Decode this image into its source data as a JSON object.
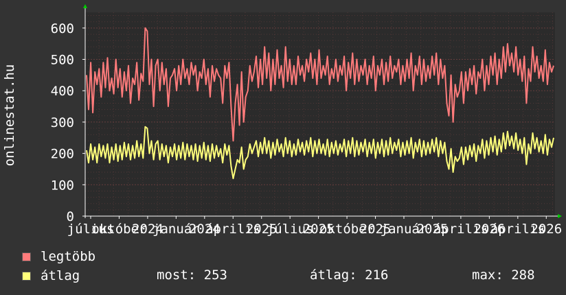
{
  "side_label": "onlinestat.hu",
  "legend": [
    {
      "name": "legtöbb",
      "color": "#ff7b7b"
    },
    {
      "name": "átlag",
      "color": "#ffff7b"
    }
  ],
  "stats": {
    "now": "most: 253",
    "avg": "átlag: 216",
    "max": "max: 288"
  },
  "colors": {
    "background": "#333333",
    "plot_bg": "#2b2b2b",
    "grid": "#6a3f3f",
    "axis": "#ffffff",
    "arrow": "#00cc00"
  },
  "chart_data": {
    "type": "line",
    "ylim": [
      0,
      650
    ],
    "yticks": [
      0,
      100,
      200,
      300,
      400,
      500,
      600
    ],
    "xtick_labels": [
      "július",
      "október",
      "2024",
      "január",
      "2024",
      "április",
      "2025",
      "július",
      "2025",
      "október",
      "2025",
      "január",
      "2025",
      "április",
      "2026",
      "április",
      "2026"
    ],
    "series": [
      {
        "name": "legtöbb",
        "color": "#ff7b7b",
        "values": [
          450,
          340,
          490,
          330,
          460,
          420,
          470,
          380,
          490,
          410,
          505,
          400,
          440,
          390,
          500,
          410,
          470,
          380,
          460,
          400,
          480,
          360,
          440,
          420,
          490,
          370,
          455,
          430,
          600,
          590,
          420,
          500,
          350,
          480,
          500,
          400,
          490,
          420,
          470,
          350,
          440,
          450,
          470,
          400,
          480,
          420,
          500,
          440,
          470,
          420,
          490,
          450,
          480,
          400,
          460,
          440,
          500,
          420,
          470,
          380,
          480,
          430,
          470,
          450,
          440,
          360,
          480,
          440,
          490,
          350,
          240,
          360,
          420,
          290,
          460,
          300,
          380,
          400,
          480,
          430,
          460,
          510,
          410,
          500,
          420,
          540,
          440,
          520,
          400,
          500,
          420,
          530,
          440,
          480,
          410,
          540,
          430,
          500,
          420,
          480,
          420,
          510,
          450,
          480,
          430,
          500,
          460,
          520,
          440,
          500,
          420,
          530,
          440,
          480,
          450,
          510,
          420,
          470,
          440,
          500,
          430,
          480,
          450,
          510,
          400,
          490,
          440,
          520,
          420,
          500,
          430,
          480,
          450,
          500,
          420,
          480,
          440,
          510,
          400,
          480,
          450,
          500,
          420,
          490,
          430,
          510,
          440,
          480,
          460,
          500,
          420,
          480,
          430,
          500,
          440,
          520,
          400,
          480,
          450,
          510,
          420,
          500,
          430,
          480,
          440,
          510,
          450,
          520,
          420,
          500,
          440,
          480,
          360,
          320,
          450,
          300,
          420,
          380,
          400,
          460,
          360,
          460,
          400,
          470,
          420,
          480,
          390,
          460,
          440,
          500,
          400,
          480,
          420,
          510,
          450,
          520,
          420,
          500,
          440,
          540,
          460,
          550,
          480,
          520,
          460,
          540,
          450,
          500,
          430,
          510,
          360,
          470,
          430,
          540,
          460,
          510,
          440,
          480,
          430,
          530,
          420,
          490,
          460,
          480
        ]
      },
      {
        "name": "átlag",
        "color": "#ffff7b",
        "values": [
          210,
          170,
          230,
          180,
          220,
          170,
          230,
          190,
          225,
          185,
          230,
          170,
          220,
          180,
          230,
          175,
          225,
          180,
          235,
          190,
          230,
          180,
          225,
          185,
          240,
          190,
          230,
          185,
          285,
          280,
          200,
          240,
          180,
          230,
          240,
          180,
          230,
          190,
          225,
          170,
          220,
          190,
          230,
          180,
          225,
          185,
          235,
          180,
          230,
          190,
          225,
          180,
          230,
          175,
          225,
          185,
          235,
          180,
          225,
          175,
          230,
          185,
          225,
          190,
          215,
          170,
          230,
          195,
          225,
          160,
          120,
          150,
          180,
          170,
          220,
          150,
          180,
          190,
          230,
          200,
          220,
          240,
          190,
          235,
          200,
          250,
          200,
          240,
          185,
          235,
          195,
          245,
          205,
          230,
          190,
          250,
          200,
          240,
          190,
          230,
          195,
          245,
          205,
          235,
          195,
          240,
          205,
          250,
          190,
          240,
          200,
          245,
          200,
          230,
          195,
          245,
          190,
          235,
          200,
          240,
          195,
          230,
          205,
          245,
          190,
          240,
          200,
          250,
          190,
          240,
          195,
          235,
          205,
          245,
          190,
          235,
          200,
          245,
          185,
          235,
          200,
          245,
          190,
          240,
          195,
          250,
          200,
          235,
          210,
          245,
          190,
          235,
          195,
          240,
          200,
          250,
          185,
          235,
          205,
          245,
          190,
          240,
          195,
          235,
          200,
          245,
          205,
          250,
          190,
          240,
          200,
          235,
          175,
          150,
          215,
          140,
          190,
          175,
          185,
          220,
          165,
          220,
          180,
          225,
          190,
          230,
          175,
          225,
          200,
          245,
          185,
          240,
          195,
          250,
          205,
          255,
          195,
          245,
          205,
          265,
          215,
          270,
          225,
          255,
          215,
          265,
          210,
          245,
          200,
          250,
          165,
          230,
          200,
          265,
          215,
          250,
          205,
          240,
          200,
          260,
          195,
          245,
          220,
          250
        ]
      }
    ]
  }
}
